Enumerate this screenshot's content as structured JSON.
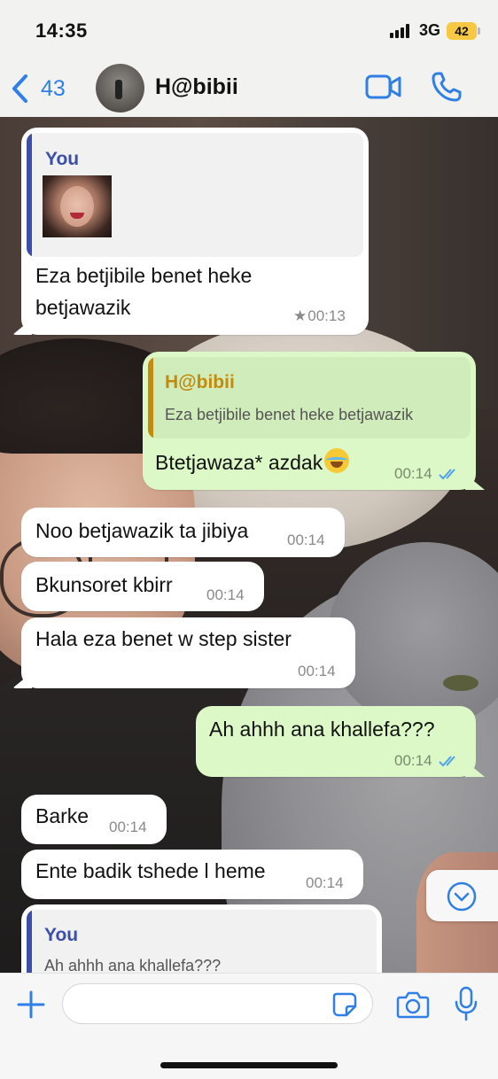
{
  "status_bar": {
    "time": "14:35",
    "network": "3G",
    "battery": "42"
  },
  "header": {
    "back_count": "43",
    "contact_name": "H@bibii"
  },
  "messages": [
    {
      "direction": "incoming",
      "quote": {
        "author": "You",
        "has_image": true
      },
      "text_line1": "Eza betjibile benet heke",
      "text_line2": "betjawazik",
      "starred": true,
      "time": "00:13"
    },
    {
      "direction": "outgoing",
      "quote": {
        "author": "H@bibii",
        "text": "Eza betjibile benet heke betjawazik"
      },
      "text": "Btetjawaza* azdak",
      "emoji": "face-with-tears-of-joy",
      "time": "00:14",
      "read": true
    },
    {
      "direction": "incoming",
      "text": "Noo betjawazik ta jibiya",
      "time": "00:14"
    },
    {
      "direction": "incoming",
      "text": "Bkunsoret kbirr",
      "time": "00:14"
    },
    {
      "direction": "incoming",
      "text": "Hala eza benet w step sister",
      "time": "00:14"
    },
    {
      "direction": "outgoing",
      "text": "Ah ahhh ana khallefa???",
      "time": "00:14",
      "read": true
    },
    {
      "direction": "incoming",
      "text": "Barke",
      "time": "00:14"
    },
    {
      "direction": "incoming",
      "text": "Ente badik tshede l heme",
      "time": "00:14"
    },
    {
      "direction": "incoming",
      "quote": {
        "author": "You",
        "text": "Ah ahhh ana khallefa???"
      }
    }
  ],
  "composer": {
    "placeholder": ""
  },
  "colors": {
    "accent": "#2f7fe6",
    "outgoing_bubble": "#dcf8c6",
    "incoming_bubble": "#ffffff",
    "quote_you": "#3b4ea8",
    "quote_habibii": "#c48a0c",
    "read_ticks": "#4fa3e8"
  },
  "icons": [
    "back-chevron-icon",
    "video-call-icon",
    "phone-icon",
    "scroll-down-icon",
    "plus-icon",
    "sticker-icon",
    "camera-icon",
    "microphone-icon",
    "star-icon",
    "double-check-icon",
    "laughing-emoji-icon"
  ]
}
